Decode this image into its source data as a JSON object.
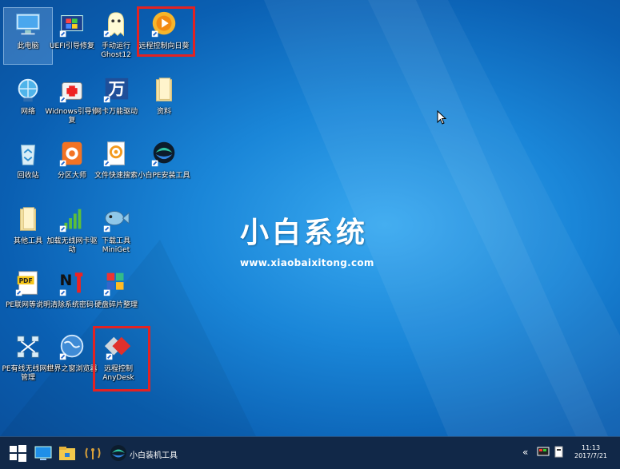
{
  "desktop": {
    "icons": [
      {
        "label": "此电脑"
      },
      {
        "label": "UEFI引导修复"
      },
      {
        "label": "手动运行Ghost12"
      },
      {
        "label": "远程控制向日葵"
      },
      {
        "label": "网络"
      },
      {
        "label": "Widnows引导修复"
      },
      {
        "label": "网卡万能驱动"
      },
      {
        "label": "资料"
      },
      {
        "label": "回收站"
      },
      {
        "label": "分区大师"
      },
      {
        "label": "文件快速搜索"
      },
      {
        "label": "小白PE安装工具"
      },
      {
        "label": "其他工具"
      },
      {
        "label": "加载无线网卡驱动"
      },
      {
        "label": "下载工具MiniGet"
      },
      {
        "label": "PE联网等说明"
      },
      {
        "label": "清除系统密码"
      },
      {
        "label": "硬盘碎片整理"
      },
      {
        "label": "PE有线无线网络管理"
      },
      {
        "label": "世界之窗浏览器"
      },
      {
        "label": "远程控制AnyDesk"
      }
    ]
  },
  "brand": {
    "title": "小白系统",
    "url": "www.xiaobaixitong.com"
  },
  "taskbar": {
    "app_label": "小白装机工具",
    "tray_chevron": "«",
    "clock_time": "11:13",
    "clock_date": "2017/7/21"
  },
  "highlight_color": "#e32222"
}
